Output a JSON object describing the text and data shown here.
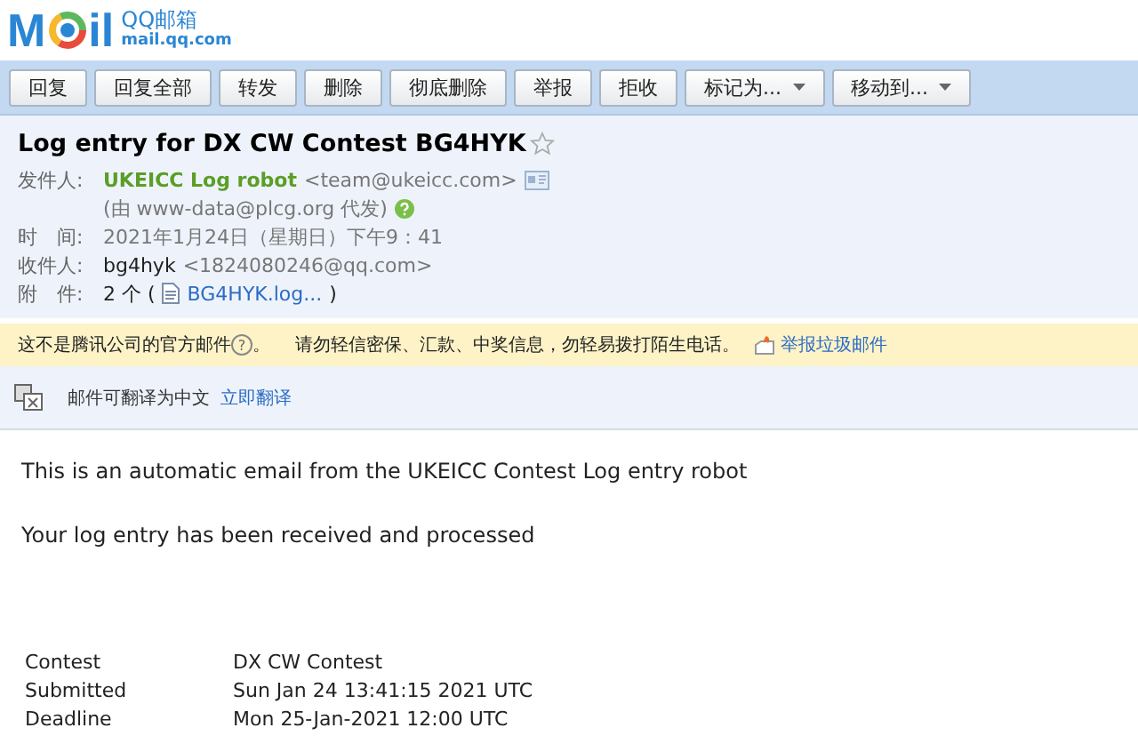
{
  "logo": {
    "prefix": "M",
    "suffix": "il",
    "title": "QQ邮箱",
    "domain": "mail.qq.com"
  },
  "toolbar": [
    {
      "label": "回复",
      "kind": "button"
    },
    {
      "label": "回复全部",
      "kind": "button"
    },
    {
      "label": "转发",
      "kind": "button"
    },
    {
      "label": "删除",
      "kind": "button"
    },
    {
      "label": "彻底删除",
      "kind": "button"
    },
    {
      "label": "举报",
      "kind": "button"
    },
    {
      "label": "拒收",
      "kind": "button"
    },
    {
      "label": "标记为...",
      "kind": "dropdown"
    },
    {
      "label": "移动到...",
      "kind": "dropdown"
    }
  ],
  "subject": "Log entry for DX CW Contest BG4HYK",
  "starred": false,
  "sender": {
    "label": "发件人:",
    "name": "UKEICC Log robot",
    "email": "<team@ukeicc.com>",
    "via": "(由 www-data@plcg.org 代发)"
  },
  "time": {
    "label": "时　间:",
    "value": "2021年1月24日（星期日）下午9：41"
  },
  "recipient": {
    "label": "收件人:",
    "name": "bg4hyk",
    "email": "<1824080246@qq.com>"
  },
  "attachments": {
    "label": "附　件:",
    "count": "2 个 (",
    "file": "BG4HYK.log...",
    "close": ")"
  },
  "warning": {
    "text": "这不是腾讯公司的官方邮件",
    "help": "?",
    "sep": "。",
    "advice": "请勿轻信密保、汇款、中奖信息，勿轻易拨打陌生电话。",
    "report": "举报垃圾邮件"
  },
  "translate": {
    "text": "邮件可翻译为中文",
    "link": "立即翻译"
  },
  "body": {
    "paragraphs": [
      "This is an automatic email from the UKEICC Contest Log entry robot",
      "Your log entry has been received and processed"
    ],
    "rows": [
      {
        "key": "Contest",
        "value": "DX CW Contest"
      },
      {
        "key": "Submitted",
        "value": "Sun Jan 24 13:41:15 2021 UTC"
      },
      {
        "key": "Deadline",
        "value": "Mon 25-Jan-2021 12:00 UTC"
      }
    ]
  }
}
